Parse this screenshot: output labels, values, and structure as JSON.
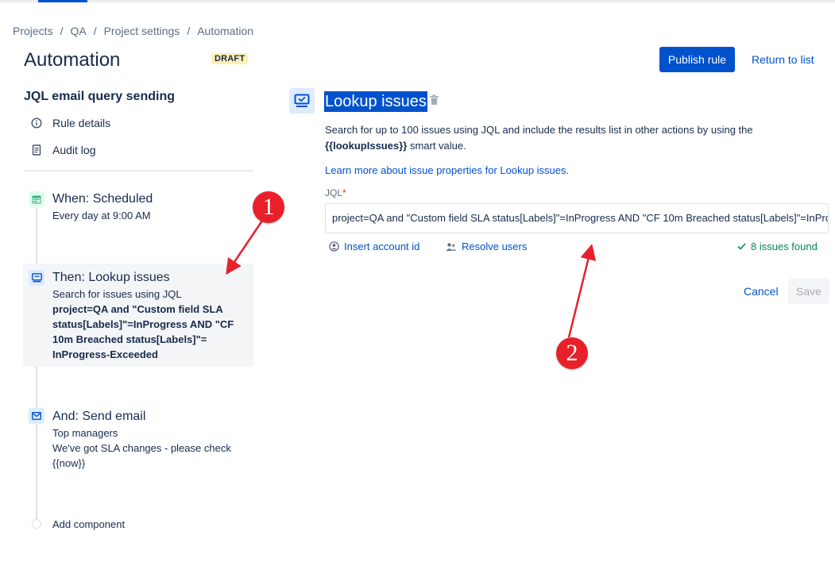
{
  "breadcrumb": [
    "Projects",
    "QA",
    "Project settings",
    "Automation"
  ],
  "breadcrumb_sep": "/",
  "header": {
    "title": "Automation",
    "badge": "DRAFT",
    "publish_label": "Publish rule",
    "return_label": "Return to list"
  },
  "sidebar": {
    "rule_name": "JQL email query sending",
    "links": [
      {
        "label": "Rule details",
        "icon": "info-icon"
      },
      {
        "label": "Audit log",
        "icon": "document-icon"
      }
    ],
    "steps": [
      {
        "title": "When: Scheduled",
        "subtitle": "Every day at 9:00 AM",
        "icon": "calendar-icon",
        "color": "#36b37e"
      },
      {
        "title": "Then: Lookup issues",
        "subtitle": "Search for issues using JQL",
        "query_lines": [
          "project=QA and \"Custom field SLA",
          "status[Labels]\"=InProgress AND \"CF",
          "10m Breached status[Labels]\"=",
          "InProgress-Exceeded"
        ],
        "icon": "lookup-icon",
        "color": "#0052cc"
      },
      {
        "title": "And: Send email",
        "lines": [
          "Top managers",
          "We've got SLA changes - please check",
          "{{now}}"
        ],
        "icon": "email-icon",
        "color": "#0052cc"
      }
    ],
    "add_component": "Add component"
  },
  "component": {
    "title": "Lookup issues",
    "desc_part1": "Search for up to 100 issues using JQL and include the results list in other actions by using the",
    "desc_smart": "{{lookupIssues}}",
    "desc_part2": " smart value.",
    "learn_more": "Learn more about issue properties for Lookup issues.",
    "jql_label": "JQL",
    "required_mark": "*",
    "jql_value": "project=QA and \"Custom field SLA status[Labels]\"=InProgress AND \"CF 10m Breached status[Labels]\"=InProgress-Exceeded",
    "insert_account": "Insert account id",
    "resolve_users": "Resolve users",
    "issues_found": "8 issues found",
    "cancel_label": "Cancel",
    "save_label": "Save"
  },
  "annotations": {
    "marker1": "1",
    "marker2": "2",
    "color": "#e8202a"
  }
}
